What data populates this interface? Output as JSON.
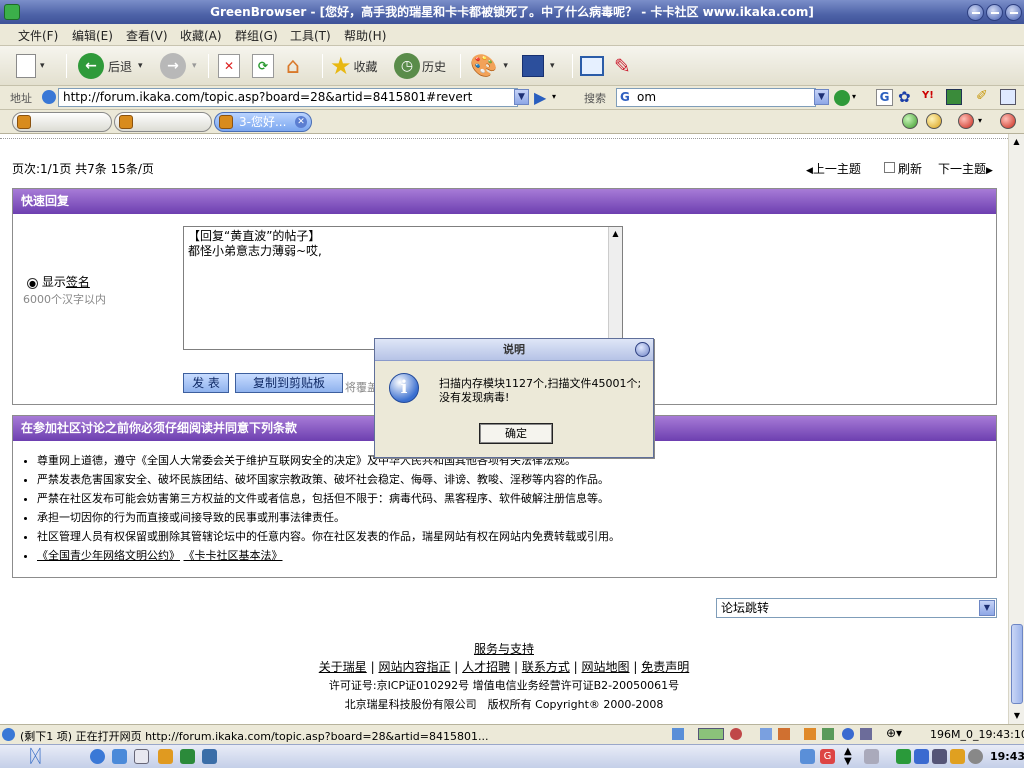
{
  "window": {
    "title": "GreenBrowser - [您好，高手我的瑞星和卡卡都被锁死了。中了什么病毒呢？ - 卡卡社区 www.ikaka.com]"
  },
  "menu": {
    "items": [
      "文件(F)",
      "编辑(E)",
      "查看(V)",
      "收藏(A)",
      "群组(G)",
      "工具(T)",
      "帮助(H)"
    ]
  },
  "toolbar": {
    "back_label": "后退",
    "favorites_label": "收藏",
    "history_label": "历史"
  },
  "addressbar": {
    "label": "地址",
    "url": "http://forum.ikaka.com/topic.asp?board=28&artid=8415801#revert",
    "search_label": "搜索",
    "search_value": "om"
  },
  "tabs": [
    {
      "label": ""
    },
    {
      "label": ""
    },
    {
      "label": "3-您好..."
    }
  ],
  "page": {
    "pagination": "页次:1/1页 共7条 15条/页",
    "prev_topic": "上一主题",
    "refresh": "刷新",
    "next_topic": "下一主题",
    "quick_reply": {
      "heading": "快速回复",
      "show_sig_prefix": "显示",
      "show_sig_link": "签名",
      "char_limit": "6000个汉字以内",
      "textarea_line1": "【回复“黄直波”的帖子】",
      "textarea_line2": "都怪小弟意志力薄弱~哎,",
      "submit_label": "发 表",
      "copy_label": "复制到剪贴板",
      "hint_text": "将覆盖"
    },
    "terms": {
      "heading": "在参加社区讨论之前你必须仔细阅读并同意下列条款",
      "items": [
        "尊重网上道德，遵守《全国人大常委会关于维护互联网安全的决定》及中华人民共和国其他各项有关法律法规。",
        "严禁发表危害国家安全、破坏民族团结、破坏国家宗教政策、破坏社会稳定、侮辱、诽谤、教唆、淫秽等内容的作品。",
        "严禁在社区发布可能会妨害第三方权益的文件或者信息，包括但不限于：病毒代码、黑客程序、软件破解注册信息等。",
        "承担一切因你的行为而直接或间接导致的民事或刑事法律责任。",
        "社区管理人员有权保留或删除其管辖论坛中的任意内容。你在社区发表的作品，瑞星网站有权在网站内免费转载或引用。"
      ],
      "link1": "《全国青少年网络文明公约》",
      "link2": "《卡卡社区基本法》"
    },
    "forum_jump": "论坛跳转",
    "footer": {
      "service": "服务与支持",
      "links": [
        "关于瑞星",
        "网站内容指正",
        "人才招聘",
        "联系方式",
        "网站地图",
        "免责声明"
      ],
      "license": "许可证号:京ICP证010292号 增值电信业务经营许可证B2-20050061号",
      "company": "北京瑞星科技股份有限公司　版权所有 Copyright® 2000-2008"
    }
  },
  "dialog": {
    "title": "说明",
    "message_line1": "扫描内存模块1127个,扫描文件45001个;",
    "message_line2": "没有发现病毒!",
    "ok_label": "确定"
  },
  "status": {
    "text": "(剩下1 项) 正在打开网页 http://forum.ikaka.com/topic.asp?board=28&artid=8415801...",
    "right_text": "196M_0_19:43:10"
  },
  "taskbar": {
    "clock": "19:43"
  }
}
